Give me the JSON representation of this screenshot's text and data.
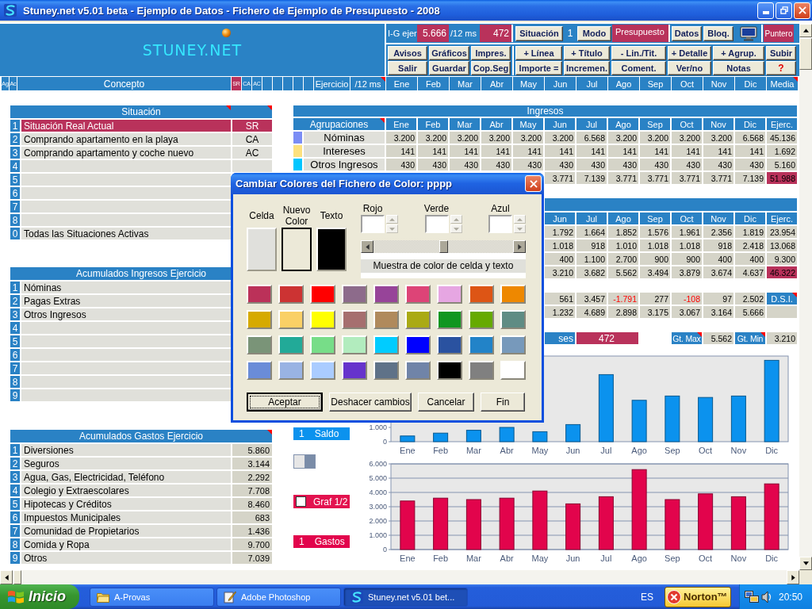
{
  "window": {
    "title": "Stuney.net v5.01 beta - Ejemplo de Datos - Fichero de Ejemplo de Presupuesto - 2008"
  },
  "toolbar": {
    "logo": "STUNEY.NET",
    "stats": [
      {
        "label": "I-G ejer",
        "value": "5.666"
      },
      {
        "label": "/12 ms",
        "value": "472"
      }
    ],
    "situation_button": "Situación",
    "situation_number": "1",
    "mode_button": "Modo",
    "mode_value": "Presupuesto",
    "buttons_top": [
      "Datos",
      "Bloq."
    ],
    "pointer": "Puntero",
    "button_rows": [
      [
        "Avisos",
        "Gráficos",
        "Impres.",
        "+ Línea",
        "+ Título",
        "- Lin./Tit.",
        "+ Detalle",
        "+ Agrup.",
        "Subir"
      ],
      [
        "Salir",
        "Guardar",
        "Cop.Seg",
        "Importe =",
        "Incremen.",
        "Coment.",
        "Ver/no",
        "Notas"
      ]
    ],
    "help_label": "?"
  },
  "header_row": {
    "small": [
      "Ag",
      "Ac"
    ],
    "concept": "Concepto",
    "situation_codes": [
      {
        "code": "SR",
        "selected": true
      },
      {
        "code": "CA",
        "selected": false
      },
      {
        "code": "AC",
        "selected": false
      }
    ],
    "year": "Ejercicio",
    "per_month": {
      "text": "/12 ms",
      "note": true
    },
    "months": [
      "Ene",
      "Feb",
      "Mar",
      "Abr",
      "May",
      "Jun",
      "Jul",
      "Ago",
      "Sep",
      "Oct",
      "Nov",
      "Dic"
    ],
    "average": {
      "text": "Media",
      "note": true
    }
  },
  "situacion": {
    "title": "Situación",
    "label_note": true,
    "note": true,
    "rows": [
      {
        "number": "1",
        "label": "Situación Real Actual",
        "code": "SR",
        "selected": true
      },
      {
        "number": "2",
        "label": "Comprando apartamento en la playa",
        "code": "CA",
        "selected": false
      },
      {
        "number": "3",
        "label": "Comprando apartamento y coche nuevo",
        "code": "AC",
        "selected": false
      },
      {
        "number": "4",
        "selected": false
      },
      {
        "number": "5",
        "selected": false
      },
      {
        "number": "6",
        "selected": false
      },
      {
        "number": "7",
        "selected": false
      },
      {
        "number": "8",
        "selected": false
      },
      {
        "number": "0",
        "label": "Todas las Situaciones Activas",
        "selected": false
      }
    ]
  },
  "acumulados_ingresos": {
    "title": "Acumulados Ingresos Ejercicio",
    "rows": [
      {
        "number": "1",
        "label": "Nóminas"
      },
      {
        "number": "2",
        "label": "Pagas Extras"
      },
      {
        "number": "3",
        "label": "Otros Ingresos"
      },
      {
        "number": "4"
      },
      {
        "number": "5"
      },
      {
        "number": "6"
      },
      {
        "number": "7"
      },
      {
        "number": "8"
      },
      {
        "number": "9"
      }
    ]
  },
  "acumulados_gastos": {
    "title": "Acumulados Gastos Ejercicio",
    "note": true,
    "rows": [
      {
        "number": "1",
        "label": "Diversiones",
        "value": "5.860"
      },
      {
        "number": "2",
        "label": "Seguros",
        "value": "3.144"
      },
      {
        "number": "3",
        "label": "Agua, Gas, Electricidad, Teléfono",
        "value": "2.292"
      },
      {
        "number": "4",
        "label": "Colegio y Extraescolares",
        "value": "7.708"
      },
      {
        "number": "5",
        "label": "Hipotecas y Créditos",
        "value": "8.460"
      },
      {
        "number": "6",
        "label": "Impuestos Municipales",
        "value": "683"
      },
      {
        "number": "7",
        "label": "Comunidad de Propietarios",
        "value": "1.436"
      },
      {
        "number": "8",
        "label": "Comida y Ropa",
        "value": "9.700"
      },
      {
        "number": "9",
        "label": "Otros",
        "value": "7.039"
      }
    ]
  },
  "ingresos": {
    "title": "Ingresos",
    "group_header": {
      "text": "Agrupaciones",
      "note": true
    },
    "columns": [
      "Ene",
      "Feb",
      "Mar",
      "Abr",
      "May",
      "Jun",
      "Jul",
      "Ago",
      "Sep",
      "Oct",
      "Nov",
      "Dic",
      "Ejerc."
    ],
    "rows": [
      {
        "color": "#7b8df5",
        "label": "Nóminas",
        "values": [
          "3.200",
          "3.200",
          "3.200",
          "3.200",
          "3.200",
          "3.200",
          "6.568",
          "3.200",
          "3.200",
          "3.200",
          "3.200",
          "6.568"
        ],
        "total": "45.136",
        "highlight": false
      },
      {
        "color": "#fde17e",
        "label": "Intereses",
        "values": [
          "141",
          "141",
          "141",
          "141",
          "141",
          "141",
          "141",
          "141",
          "141",
          "141",
          "141",
          "141"
        ],
        "total": "1.692",
        "highlight": false
      },
      {
        "color": "#00c6ff",
        "label": "Otros Ingresos",
        "values": [
          "430",
          "430",
          "430",
          "430",
          "430",
          "430",
          "430",
          "430",
          "430",
          "430",
          "430",
          "430"
        ],
        "total": "5.160",
        "highlight": false
      },
      {
        "values": [
          "3.771",
          "7.139",
          "3.771",
          "3.771",
          "3.771",
          "3.771",
          "7.139"
        ],
        "total": "51.988",
        "highlight": true
      }
    ]
  },
  "table_2": {
    "columns": [
      "Jun",
      "Jul",
      "Ago",
      "Sep",
      "Oct",
      "Nov",
      "Dic",
      "Ejerc."
    ],
    "rows": [
      {
        "values": [
          "1.792",
          "1.664",
          "1.852",
          "1.576",
          "1.961",
          "2.356",
          "1.819"
        ],
        "total": "23.954",
        "highlight": false
      },
      {
        "values": [
          "1.018",
          "918",
          "1.010",
          "1.018",
          "1.018",
          "918",
          "2.418"
        ],
        "total": "13.068",
        "highlight": false
      },
      {
        "values": [
          "400",
          "1.100",
          "2.700",
          "900",
          "900",
          "400",
          "400"
        ],
        "total": "9.300",
        "highlight": false
      },
      {
        "values": [
          "3.210",
          "3.682",
          "5.562",
          "3.494",
          "3.879",
          "3.674",
          "4.637"
        ],
        "total": "46.322",
        "highlight": true
      }
    ],
    "balance_rows": [
      {
        "values": [
          "561",
          "3.457",
          "-1.791",
          "277",
          "-108",
          "97",
          "2.502"
        ],
        "negative": [
          false,
          false,
          true,
          false,
          true,
          false,
          false
        ],
        "total_label": {
          "text": "D.S.I.",
          "note": true
        }
      },
      {
        "values": [
          "1.232",
          "4.689",
          "2.898",
          "3.175",
          "3.067",
          "3.164",
          "5.666"
        ],
        "negative": [
          false,
          false,
          false,
          false,
          false,
          false,
          false
        ]
      }
    ],
    "summary": {
      "label": "ses",
      "value": "472",
      "max_label": {
        "text": "Gt. Max",
        "note": true
      },
      "max_value": "5.562",
      "min_label": {
        "text": "Gt. Min",
        "note": true
      },
      "min_value": "3.210"
    }
  },
  "charts": [
    {
      "selector": {
        "number": "1",
        "label": "Saldo"
      },
      "chart_data": {
        "type": "bar",
        "categories": [
          "Ene",
          "Feb",
          "Mar",
          "Abr",
          "May",
          "Jun",
          "Jul",
          "Ago",
          "Sep",
          "Oct",
          "Nov",
          "Dic"
        ],
        "series": [
          {
            "color": "#0b92ee",
            "values": [
              0.4,
              0.6,
              0.8,
              1.0,
              0.7,
              1.2,
              4.7,
              2.9,
              3.2,
              3.1,
              3.2,
              5.7
            ]
          }
        ],
        "ylim": [
          0,
          6
        ],
        "yticks": [
          {
            "value": 0,
            "label": "0"
          },
          {
            "value": 1,
            "label": "1.000"
          }
        ]
      }
    },
    {
      "selector": {
        "number": "1",
        "label": "Gastos"
      },
      "chart_data": {
        "type": "bar",
        "categories": [
          "Ene",
          "Feb",
          "Mar",
          "Abr",
          "May",
          "Jun",
          "Jul",
          "Ago",
          "Sep",
          "Oct",
          "Nov",
          "Dic"
        ],
        "series": [
          {
            "color": "#e2044c",
            "values": [
              3.4,
              3.6,
              3.5,
              3.6,
              4.1,
              3.2,
              3.7,
              5.6,
              3.5,
              3.9,
              3.7,
              4.6
            ]
          }
        ],
        "ylim": [
          0,
          6
        ],
        "yticks": [
          {
            "value": 0,
            "label": "0"
          },
          {
            "value": 1,
            "label": "1.000"
          },
          {
            "value": 2,
            "label": "2.000"
          },
          {
            "value": 3,
            "label": "3.000"
          },
          {
            "value": 4,
            "label": "4.000"
          },
          {
            "value": 5,
            "label": "5.000"
          },
          {
            "value": 6,
            "label": "6.000"
          }
        ],
        "grid": true
      }
    }
  ],
  "graph_toggle": {
    "label": "Graf 1/2",
    "checked": false
  },
  "dialog": {
    "title": "Cambiar Colores del Fichero de Color: pppp",
    "previews": [
      {
        "label": "Celda",
        "color": "#e0e0dc",
        "selected": false
      },
      {
        "label": "Nuevo Color",
        "color": "#ece9d8",
        "selected": true
      },
      {
        "label": "Texto",
        "color": "#000000",
        "selected": false
      }
    ],
    "channels": [
      {
        "label": "Rojo"
      },
      {
        "label": "Verde"
      },
      {
        "label": "Azul"
      }
    ],
    "slider": {
      "level": 0.5
    },
    "sample": "Muestra de color de celda y texto",
    "palette": [
      {
        "color": "#bb3159"
      },
      {
        "color": "#cc3333"
      },
      {
        "color": "#ff0000"
      },
      {
        "color": "#8d6b8b"
      },
      {
        "color": "#974499"
      },
      {
        "color": "#dd4477"
      },
      {
        "color": "#e6a6e2"
      },
      {
        "color": "#dd5515"
      },
      {
        "color": "#ee8800"
      },
      {
        "color": "#d6aa00"
      },
      {
        "color": "#fad066"
      },
      {
        "color": "#ffff00"
      },
      {
        "color": "#a66f6f"
      },
      {
        "color": "#b08a5c"
      },
      {
        "color": "#aaaa14"
      },
      {
        "color": "#109620"
      },
      {
        "color": "#66aa00"
      },
      {
        "color": "#5f8c84"
      },
      {
        "color": "#7a9478"
      },
      {
        "color": "#22aa98"
      },
      {
        "color": "#77dd88"
      },
      {
        "color": "#b2ecbe"
      },
      {
        "color": "#00ccff"
      },
      {
        "color": "#0000ff"
      },
      {
        "color": "#2a52a0"
      },
      {
        "color": "#2283c8"
      },
      {
        "color": "#7799bb"
      },
      {
        "color": "#6a8cd8"
      },
      {
        "color": "#99b3e3"
      },
      {
        "color": "#aaccff"
      },
      {
        "color": "#6633cc"
      },
      {
        "color": "#5f7288"
      },
      {
        "color": "#7084a8"
      },
      {
        "color": "#000000"
      },
      {
        "color": "#808080"
      },
      {
        "color": "#ffffff"
      }
    ],
    "buttons": [
      {
        "label": "Aceptar",
        "focused": true
      },
      {
        "label": "Deshacer cambios",
        "focused": false
      },
      {
        "label": "Cancelar",
        "focused": false
      },
      {
        "label": "Fin",
        "focused": false
      }
    ]
  },
  "taskbar": {
    "start": "Inicio",
    "tasks": [
      {
        "kind": "folder",
        "label": "A-Provas",
        "selected": false
      },
      {
        "kind": "image-editor",
        "label": "Adobe Photoshop",
        "selected": false
      },
      {
        "kind": "app",
        "label": "Stuney.net v5.01 bet...",
        "selected": true
      }
    ],
    "language": "ES",
    "notification": "Norton™",
    "clock": "20:50"
  }
}
